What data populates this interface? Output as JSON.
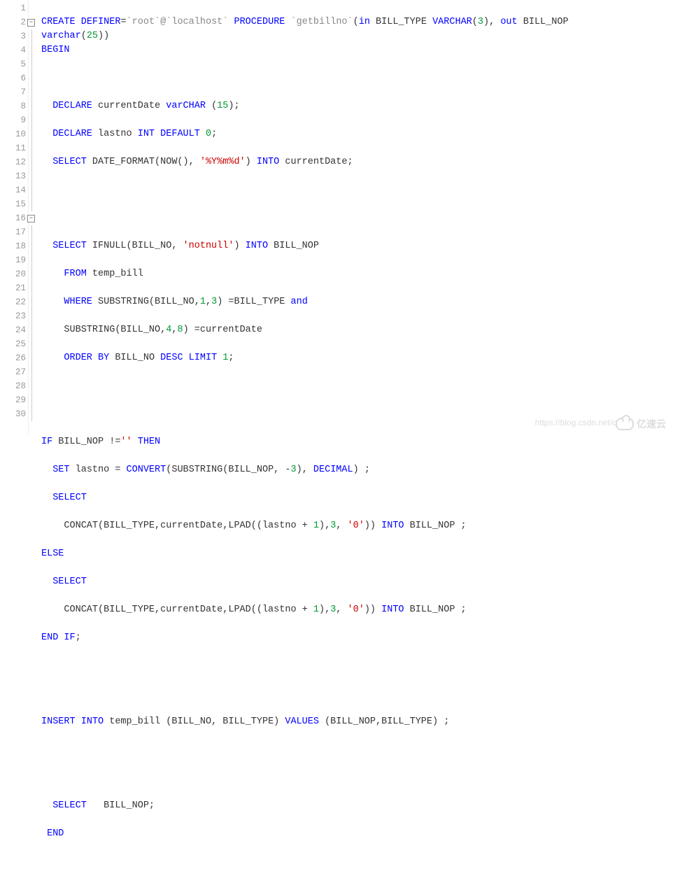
{
  "lines": {
    "l1": "CREATE DEFINER=`root`@`localhost` PROCEDURE `getbillno`(in BILL_TYPE VARCHAR(3), out BILL_NOP",
    "l1b": "varchar(25))",
    "l2": "BEGIN",
    "l3": "",
    "l4": "  DECLARE currentDate varCHAR (15);",
    "l5": "  DECLARE lastno INT DEFAULT 0;",
    "l6": "  SELECT DATE_FORMAT(NOW(), '%Y%m%d') INTO currentDate;",
    "l7": "",
    "l8": "",
    "l9": "  SELECT IFNULL(BILL_NO, 'notnull') INTO BILL_NOP",
    "l10": "    FROM temp_bill",
    "l11": "    WHERE SUBSTRING(BILL_NO,1,3) =BILL_TYPE and",
    "l12": "    SUBSTRING(BILL_NO,4,8) =currentDate",
    "l13": "    ORDER BY BILL_NO DESC LIMIT 1;",
    "l14": "",
    "l15": "",
    "l16": "IF BILL_NOP !='' THEN",
    "l17": "  SET lastno = CONVERT(SUBSTRING(BILL_NOP, -3), DECIMAL) ;",
    "l18": "  SELECT",
    "l19": "    CONCAT(BILL_TYPE,currentDate,LPAD((lastno + 1),3, '0')) INTO BILL_NOP ;",
    "l20": "ELSE",
    "l21": "  SELECT",
    "l22": "    CONCAT(BILL_TYPE,currentDate,LPAD((lastno + 1),3, '0')) INTO BILL_NOP ;",
    "l23": "END IF;",
    "l24": "",
    "l25": "",
    "l26": "INSERT INTO temp_bill (BILL_NO, BILL_TYPE) VALUES (BILL_NOP,BILL_TYPE) ;",
    "l27": "",
    "l28": "",
    "l29": "  SELECT   BILL_NOP;",
    "l30": " END"
  },
  "watermark": {
    "url": "https://blog.csdn.net/q",
    "brand": "亿速云"
  },
  "gutter_numbers": [
    "1",
    "2",
    "3",
    "4",
    "5",
    "6",
    "7",
    "8",
    "9",
    "10",
    "11",
    "12",
    "13",
    "14",
    "15",
    "16",
    "17",
    "18",
    "19",
    "20",
    "21",
    "22",
    "23",
    "24",
    "25",
    "26",
    "27",
    "28",
    "29",
    "30"
  ]
}
